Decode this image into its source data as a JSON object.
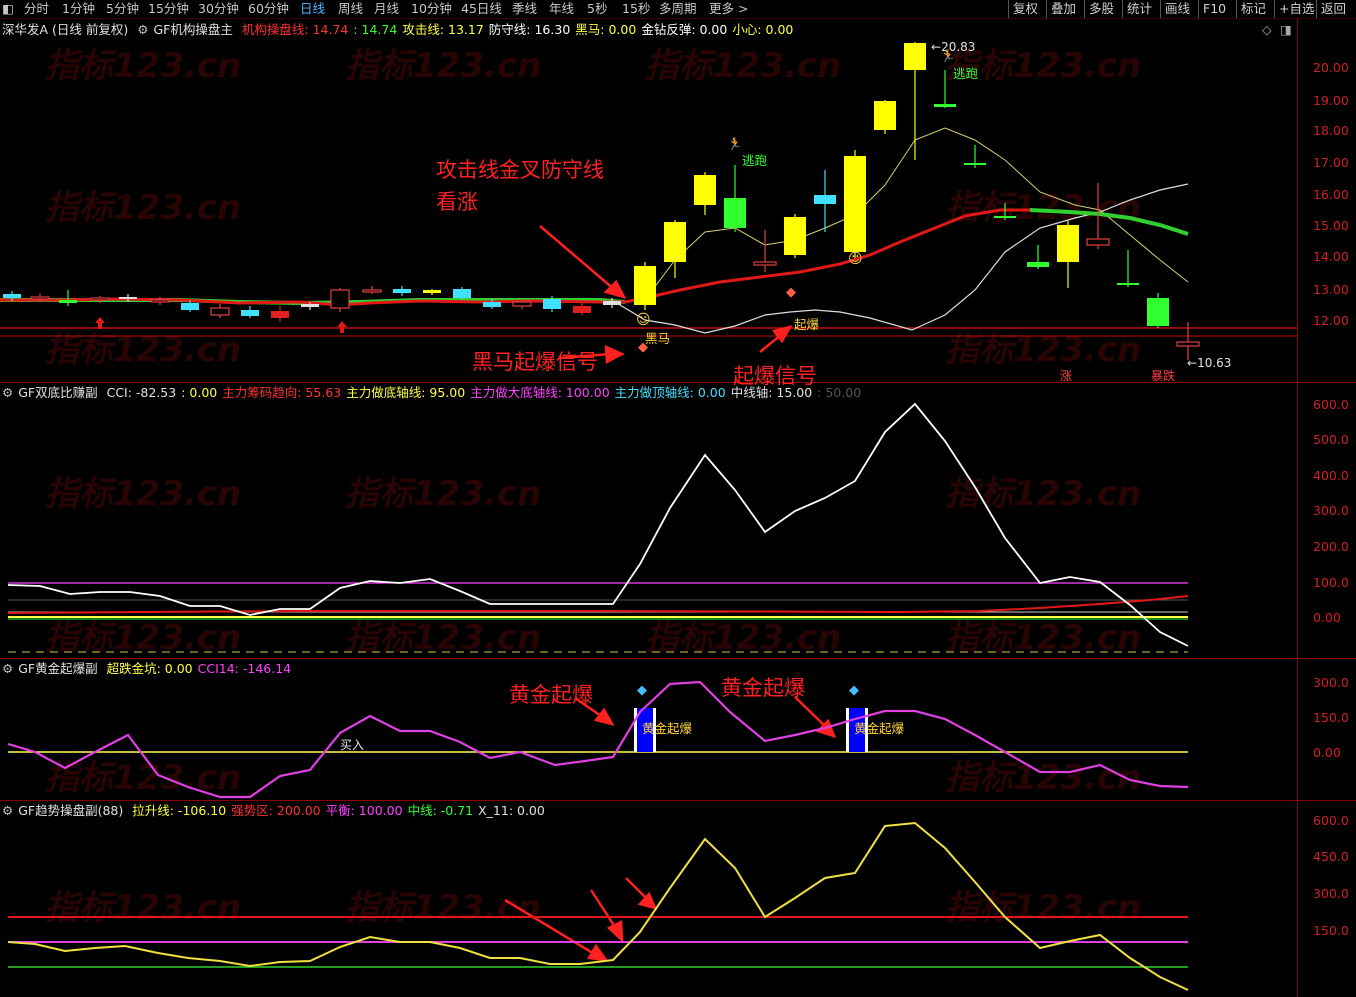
{
  "toolbar": {
    "periods": [
      "分时",
      "1分钟",
      "5分钟",
      "15分钟",
      "30分钟",
      "60分钟",
      "日线",
      "周线",
      "月线",
      "10分钟",
      "45日线",
      "季线",
      "年线",
      "5秒",
      "15秒",
      "多周期",
      "更多 >"
    ],
    "active": "日线",
    "right": [
      "复权",
      "叠加",
      "多股",
      "统计",
      "画线",
      "F10",
      "标记",
      "+自选",
      "返回"
    ]
  },
  "main_header": {
    "stock": "深华发A (日线 前复权)",
    "indicator": "GF机构操盘主",
    "items": [
      {
        "label": "机构操盘线: 14.74",
        "color": "#ff3030"
      },
      {
        "label": ": 14.74",
        "color": "#30ff30"
      },
      {
        "label": "攻击线: 13.17",
        "color": "#ffff40"
      },
      {
        "label": "防守线: 16.30",
        "color": "#ffffff"
      },
      {
        "label": "黑马: 0.00",
        "color": "#ffff40"
      },
      {
        "label": "金钻反弹: 0.00",
        "color": "#ffffff"
      },
      {
        "label": "小心: 0.00",
        "color": "#ffff40"
      }
    ]
  },
  "main_axis": [
    "20.00",
    "19.00",
    "18.00",
    "17.00",
    "16.00",
    "15.00",
    "14.00",
    "13.00",
    "12.00"
  ],
  "main_labels": {
    "high": "20.83",
    "low": "10.63",
    "escape1": "逃跑",
    "escape2": "逃跑",
    "qibao": "起爆",
    "heima": "黑马",
    "zhang": "涨",
    "baodie": "暴跌"
  },
  "annotations": {
    "a1_line1": "攻击线金叉防守线",
    "a1_line2": "看涨",
    "a2": "黑马起爆信号",
    "a3": "起爆信号",
    "a4": "黄金起爆",
    "a5": "黄金起爆"
  },
  "p2_header": {
    "name": "GF双底比赚副",
    "items": [
      {
        "label": "CCI: -82.53",
        "color": "#e0e0e0"
      },
      {
        "label": ": 0.00",
        "color": "#ffff40"
      },
      {
        "label": "主力筹码趋向: 55.63",
        "color": "#ff3030"
      },
      {
        "label": "主力做底轴线: 95.00",
        "color": "#ffff40"
      },
      {
        "label": "主力做大底轴线: 100.00",
        "color": "#ff40ff"
      },
      {
        "label": "主力做顶轴线: 0.00",
        "color": "#40e0ff"
      },
      {
        "label": "中线轴: 15.00",
        "color": "#e0e0e0"
      },
      {
        "label": ": 50.00",
        "color": "#555555"
      }
    ]
  },
  "p2_axis": [
    "600.0",
    "500.0",
    "400.0",
    "300.0",
    "200.0",
    "100.0",
    "0.00"
  ],
  "p3_header": {
    "name": "GF黄金起爆副",
    "items": [
      {
        "label": "超跌金坑: 0.00",
        "color": "#ffff40"
      },
      {
        "label": "CCI14: -146.14",
        "color": "#ff40ff"
      }
    ]
  },
  "p3_axis": [
    "300.0",
    "150.0",
    "0.00"
  ],
  "p3_labels": {
    "buy": "买入",
    "gold1": "黄金起爆",
    "gold2": "黄金起爆"
  },
  "p4_header": {
    "name": "GF趋势操盘副(88)",
    "items": [
      {
        "label": "拉升线: -106.10",
        "color": "#ffff40"
      },
      {
        "label": "强势区: 200.00",
        "color": "#ff3030"
      },
      {
        "label": "平衡: 100.00",
        "color": "#ff40ff"
      },
      {
        "label": "中线: -0.71",
        "color": "#30ff30"
      },
      {
        "label": "X_11: 0.00",
        "color": "#e0e0e0"
      }
    ]
  },
  "p4_axis": [
    "600.0",
    "450.0",
    "300.0",
    "150.0"
  ],
  "watermark": "指标123.cn",
  "colors": {
    "up": "#ffff00",
    "down": "#00e000",
    "gridred": "#8a0000"
  }
}
